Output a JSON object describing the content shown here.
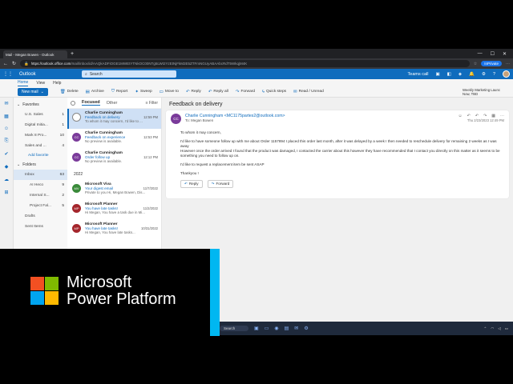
{
  "browser": {
    "tab_title": "Mail - Megan Bowen - Outlook",
    "new_tab": "+",
    "url_host": "https://outlook.office.com",
    "url_path": "/mail/inbox/id/AAQkADFiOGE1MWEtYTNkOC00NTg5LWI2YzEtNjFkM2E5ZTFmNGUyABAAbcRdT5WkqjM4K",
    "inprivate": "InPrivate"
  },
  "outlook": {
    "title": "Outlook",
    "search_placeholder": "Search",
    "teams_call": "Teams call"
  },
  "ribbon": {
    "tabs": [
      "Home",
      "View",
      "Help"
    ],
    "new_mail": "New mail",
    "actions": [
      "Delete",
      "Archive",
      "Report",
      "Sweep",
      "Move to",
      "Reply",
      "Reply all",
      "Forward",
      "Quick steps",
      "Read / Unread"
    ],
    "meeting_title": "Weekly Marketing Launc",
    "meeting_time": "Now, TBD"
  },
  "folders": {
    "favorites_label": "Favorites",
    "favorites": [
      {
        "name": "U.S. Sales",
        "count": "1"
      },
      {
        "name": "Digital Initia...",
        "count": "1"
      },
      {
        "name": "Mark 8 Pro...",
        "count": "10"
      },
      {
        "name": "Sales and ...",
        "count": "4"
      }
    ],
    "add_favorite": "Add favorite",
    "folders_label": "Folders",
    "inbox": {
      "name": "Inbox",
      "count": "63"
    },
    "subfolders": [
      {
        "name": "AI Heco",
        "count": "9"
      },
      {
        "name": "Internal S...",
        "count": "2"
      },
      {
        "name": "Project Fal...",
        "count": "5"
      }
    ],
    "drafts": "Drafts",
    "sent": "Sent Items"
  },
  "list": {
    "focused": "Focused",
    "other": "Other",
    "filter": "Filter",
    "group_2022": "2022",
    "mails": [
      {
        "initials": "",
        "color": "#ffffff",
        "sender": "Charlie Cunningham",
        "subject": "Feedback on delivery",
        "date": "12:59 PM",
        "preview": "To whom it may concern, I'd like to ..."
      },
      {
        "initials": "CC",
        "color": "#7a3a9a",
        "sender": "Charlie Cunningham",
        "subject": "Feedback on experience",
        "date": "12:53 PM",
        "preview": "No preview is available."
      },
      {
        "initials": "CC",
        "color": "#7a3a9a",
        "sender": "Charlie Cunningham",
        "subject": "Order follow up",
        "date": "12:12 PM",
        "preview": "No preview is available."
      }
    ],
    "mails_2022": [
      {
        "initials": "MV",
        "color": "#3a8a3a",
        "sender": "Microsoft Viva",
        "subject": "Your digest email",
        "date": "11/7/2022",
        "preview": "Private to you Hi, Megan Bowen, Dis..."
      },
      {
        "initials": "MP",
        "color": "#a4262c",
        "sender": "Microsoft Planner",
        "subject": "You have late tasks!",
        "date": "11/2/2022",
        "preview": "Hi Megan, You have a task due in Mi..."
      },
      {
        "initials": "MP",
        "color": "#a4262c",
        "sender": "Microsoft Planner",
        "subject": "You have late tasks!",
        "date": "10/31/2022",
        "preview": "Hi Megan, You have late tasks..."
      }
    ]
  },
  "reading": {
    "subject": "Feedback on delivery",
    "initials": "CC",
    "from": "Charlie Cunningham <MC1175partes2@outlook.com>",
    "to_label": "To:",
    "to": "Megan Bowen",
    "date": "Thu 2/23/2023 12:49 PM",
    "greeting": "To whom it may concern,",
    "para1": "I'd like to have someone follow up with me about Order 1157894 I placed this order last month, after it was delayed by a week I then needed to reschedule delivery for remaining 2 weeks as I was away",
    "para2": "However once the order arrived I found that the product was damaged, I contacted the carrier about this however they have recommended that I contact you directly on this matter as it seems to be something you need to follow up on.",
    "para3": "I'd like to request a replacement item be sent ASAP",
    "closing": "Thankyou !",
    "reply": "Reply",
    "forward": "Forward"
  },
  "taskbar": {
    "search": "Search"
  },
  "banner": {
    "line1": "Microsoft",
    "line2": "Power Platform"
  }
}
